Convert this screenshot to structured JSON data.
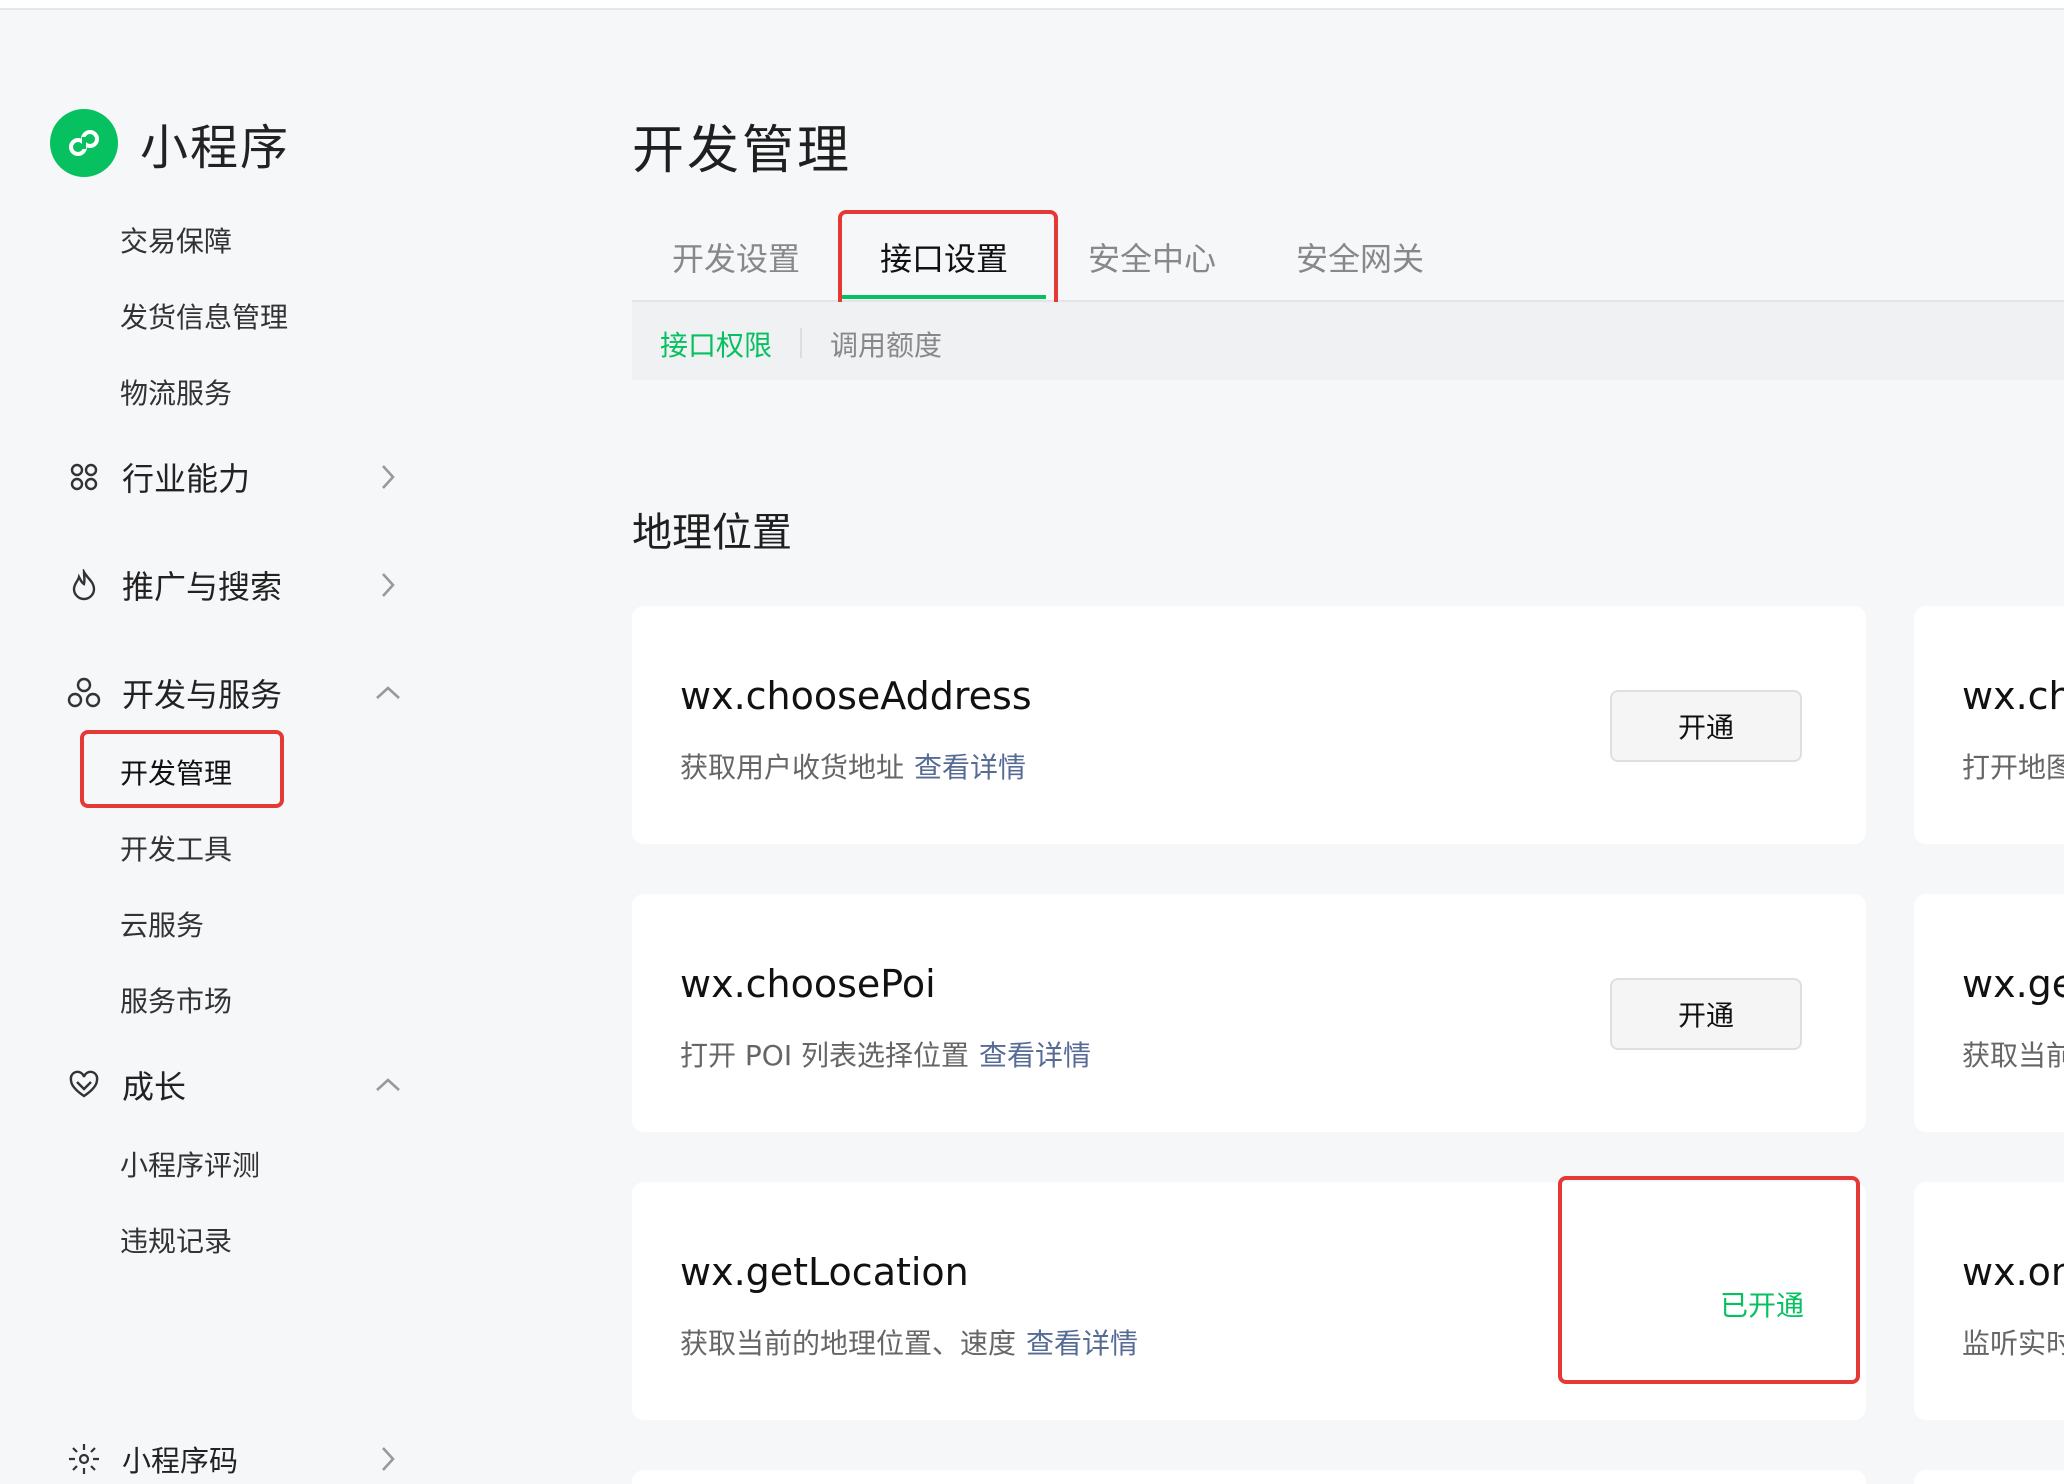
{
  "app": {
    "name": "小程序"
  },
  "sidebar": {
    "top_sub_items": [
      "交易保障",
      "发货信息管理",
      "物流服务"
    ],
    "groups": {
      "industry": "行业能力",
      "promo": "推广与搜索",
      "dev": "开发与服务",
      "growth": "成长",
      "qrcode": "小程序码"
    },
    "dev_items": [
      "开发管理",
      "开发工具",
      "云服务",
      "服务市场"
    ],
    "growth_items": [
      "小程序评测",
      "违规记录"
    ]
  },
  "main": {
    "title": "开发管理",
    "tabs": [
      "开发设置",
      "接口设置",
      "安全中心",
      "安全网关"
    ],
    "subtabs": [
      "接口权限",
      "调用额度"
    ],
    "section_title": "地理位置",
    "cards": [
      {
        "name": "wx.chooseAddress",
        "desc": "获取用户收货地址",
        "link": "查看详情",
        "action": "开通"
      },
      {
        "name": "wx.choosePoi",
        "desc": "打开 POI 列表选择位置",
        "link": "查看详情",
        "action": "开通"
      },
      {
        "name": "wx.getLocation",
        "desc": "获取当前的地理位置、速度",
        "link": "查看详情",
        "status": "已开通"
      }
    ],
    "right_cards": [
      {
        "name": "wx.ch",
        "desc": "打开地图"
      },
      {
        "name": "wx.ge",
        "desc": "获取当前"
      },
      {
        "name": "wx.on",
        "desc": "监听实时"
      }
    ]
  },
  "colors": {
    "brand_green": "#07c160",
    "link_blue": "#576b95",
    "highlight_red": "#e53935"
  }
}
